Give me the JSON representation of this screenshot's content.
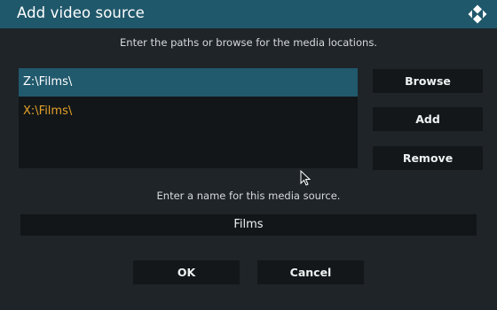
{
  "dialog": {
    "title": "Add video source",
    "paths_hint": "Enter the paths or browse for the media locations.",
    "name_hint": "Enter a name for this media source."
  },
  "paths": {
    "items": [
      {
        "label": "Z:\\Films\\",
        "state": "selected"
      },
      {
        "label": "X:\\Films\\",
        "state": "unsaved",
        "color": "#e6a12a"
      }
    ]
  },
  "side_buttons": {
    "browse": "Browse",
    "add": "Add",
    "remove": "Remove"
  },
  "source_name": {
    "value": "Films"
  },
  "footer": {
    "ok": "OK",
    "cancel": "Cancel"
  },
  "icons": {
    "logo": "kodi-logo-icon",
    "cursor": "mouse-pointer-icon"
  },
  "colors": {
    "accent": "#21596d",
    "highlight_text": "#e6a12a",
    "background": "#1e2427"
  }
}
